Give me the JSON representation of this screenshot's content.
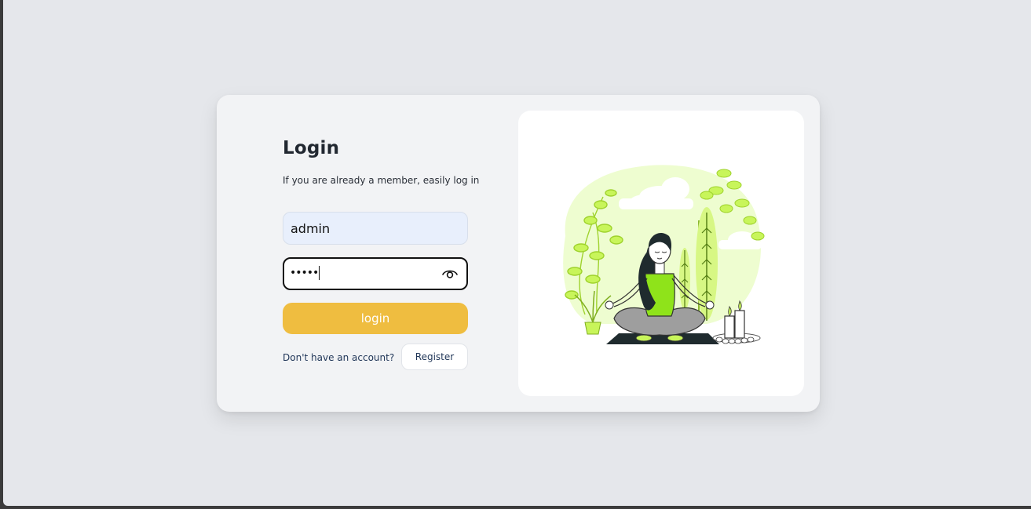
{
  "login_card": {
    "title": "Login",
    "subtitle": "If you are already a member, easily log in",
    "username": {
      "value": "admin"
    },
    "password": {
      "masked_value": "•••••",
      "visibility_icon": "eye-icon"
    },
    "login_button_label": "login",
    "register_prompt": "Don't have an account?",
    "register_button_label": "Register"
  },
  "illustration": {
    "subject": "meditating-woman-with-plants-and-candles"
  },
  "colors": {
    "page_background": "#e5e7eb",
    "card_background": "#f2f3f5",
    "accent": "#efbd40",
    "username_field": "#e8effc",
    "illustration_green": "#c5f24a"
  }
}
